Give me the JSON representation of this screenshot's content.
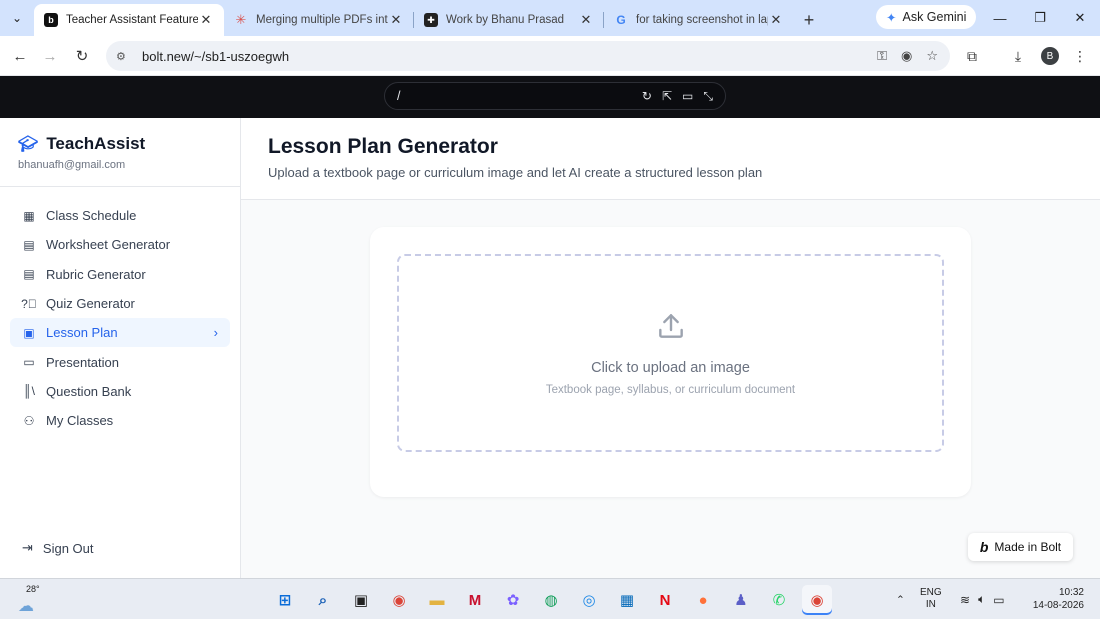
{
  "browser": {
    "tabs": [
      {
        "title": "Teacher Assistant Feature Su",
        "active": true,
        "favicon": "bolt-icon"
      },
      {
        "title": "Merging multiple PDFs into",
        "active": false,
        "favicon": "asterisk-icon"
      },
      {
        "title": "Work by Bhanu Prasad",
        "active": false,
        "favicon": "notion-icon"
      },
      {
        "title": "for taking screenshot in lapt",
        "active": false,
        "favicon": "google-icon"
      }
    ],
    "ask_gemini": "Ask Gemini",
    "url": "bolt.new/~/sb1-uszoegwh",
    "profile_initial": "B"
  },
  "bolt": {
    "path": "/",
    "made_in_bolt": "Made in Bolt"
  },
  "sidebar": {
    "brand": "TeachAssist",
    "email": "bhanuafh@gmail.com",
    "items": [
      {
        "label": "Class Schedule",
        "icon": "calendar-icon"
      },
      {
        "label": "Worksheet Generator",
        "icon": "clipboard-icon"
      },
      {
        "label": "Rubric Generator",
        "icon": "clipboard-check-icon"
      },
      {
        "label": "Quiz Generator",
        "icon": "help-circle-icon"
      },
      {
        "label": "Lesson Plan",
        "icon": "file-text-icon",
        "active": true
      },
      {
        "label": "Presentation",
        "icon": "presentation-icon"
      },
      {
        "label": "Question Bank",
        "icon": "library-icon"
      },
      {
        "label": "My Classes",
        "icon": "users-icon"
      }
    ],
    "sign_out": "Sign Out"
  },
  "main": {
    "title": "Lesson Plan Generator",
    "subtitle": "Upload a textbook page or curriculum image and let AI create a structured lesson plan",
    "upload": {
      "main_text": "Click to upload an image",
      "sub_text": "Textbook page, syllabus, or curriculum document"
    }
  },
  "taskbar": {
    "weather_temp": "28°",
    "lang_line1": "ENG",
    "lang_line2": "IN",
    "time": "10:32",
    "date": "14-08-2026"
  },
  "colors": {
    "accent": "#2563eb",
    "active_bg": "#eff6ff",
    "bolt_bar": "#0f1014",
    "tab_strip": "#d3e3fd"
  }
}
